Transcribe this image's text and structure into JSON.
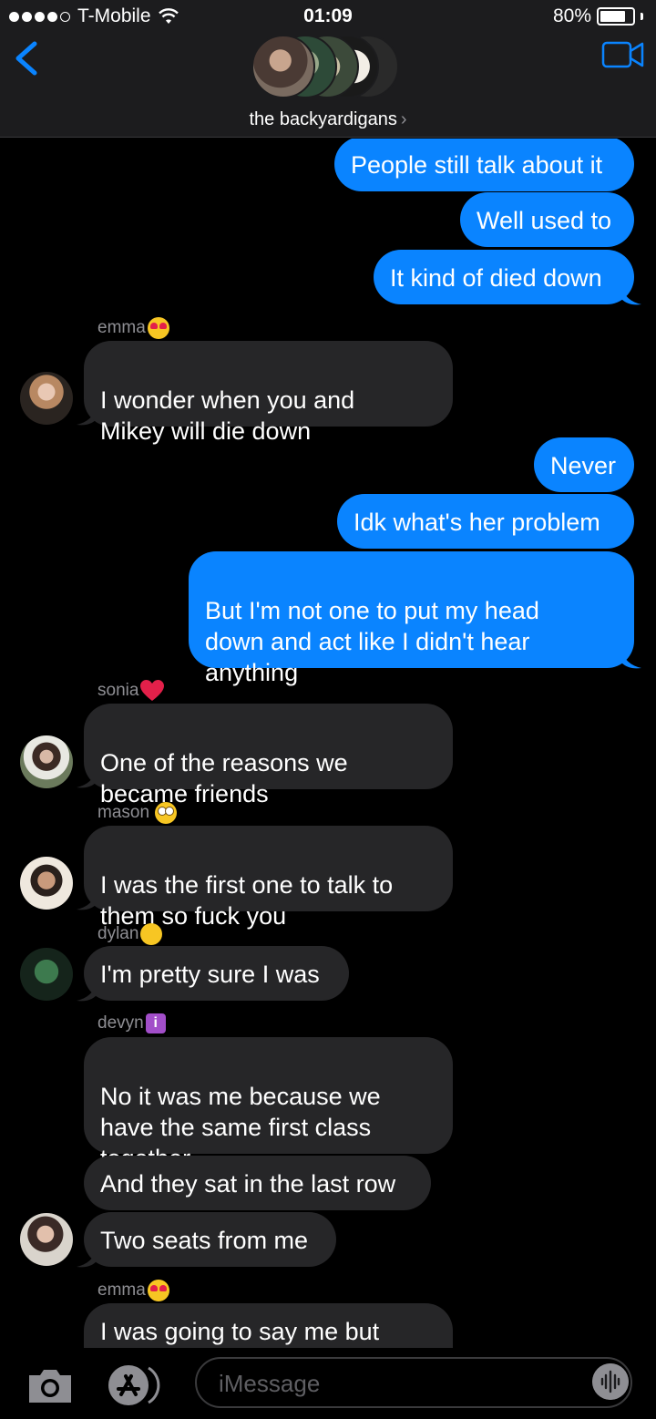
{
  "status_bar": {
    "carrier": "T-Mobile",
    "time": "01:09",
    "battery": "80%",
    "battery_level": 0.8
  },
  "header": {
    "group_name": "the backyardigans",
    "back_icon": "chevron-left-icon",
    "video_icon": "video-camera-icon"
  },
  "messages": [
    {
      "from": "me",
      "text": "People still talk about it"
    },
    {
      "from": "me",
      "text": "Well used to"
    },
    {
      "from": "me",
      "text": "It kind of died down"
    },
    {
      "from": "emma",
      "sender_label": "emma",
      "emoji": "heart-eyes",
      "text": "I wonder when you and\nMikey will die down"
    },
    {
      "from": "me",
      "text": "Never"
    },
    {
      "from": "me",
      "text": "Idk what's her problem"
    },
    {
      "from": "me",
      "text": "But I'm not one to put my head\ndown and act like I didn't hear\nanything"
    },
    {
      "from": "sonia",
      "sender_label": "sonia",
      "emoji": "heart",
      "text": "One of the reasons we\nbecame friends"
    },
    {
      "from": "mason",
      "sender_label": "mason",
      "emoji": "rolling-eyes",
      "text": "I was the first one to talk to\nthem so fuck you"
    },
    {
      "from": "dylan",
      "sender_label": "dylan",
      "emoji": "yawning",
      "text": "I'm pretty sure I was"
    },
    {
      "from": "devyn",
      "sender_label": "devyn",
      "emoji": "information",
      "text": "No it was me because we\nhave the same first class\ntogether"
    },
    {
      "from": "devyn",
      "text": "And they sat in the last row"
    },
    {
      "from": "devyn",
      "text": "Two seats from me"
    },
    {
      "from": "emma",
      "sender_label": "emma",
      "emoji": "heart-eyes",
      "text": "I was going to say me but"
    }
  ],
  "input": {
    "placeholder": "iMessage",
    "camera_icon": "camera-icon",
    "apps_icon": "app-store-icon",
    "audio_icon": "audio-waveform-icon"
  },
  "colors": {
    "background": "#000000",
    "header": "#1c1c1e",
    "sent_bubble": "#0a84ff",
    "received_bubble": "#262628",
    "secondary_text": "#8e8e93"
  }
}
